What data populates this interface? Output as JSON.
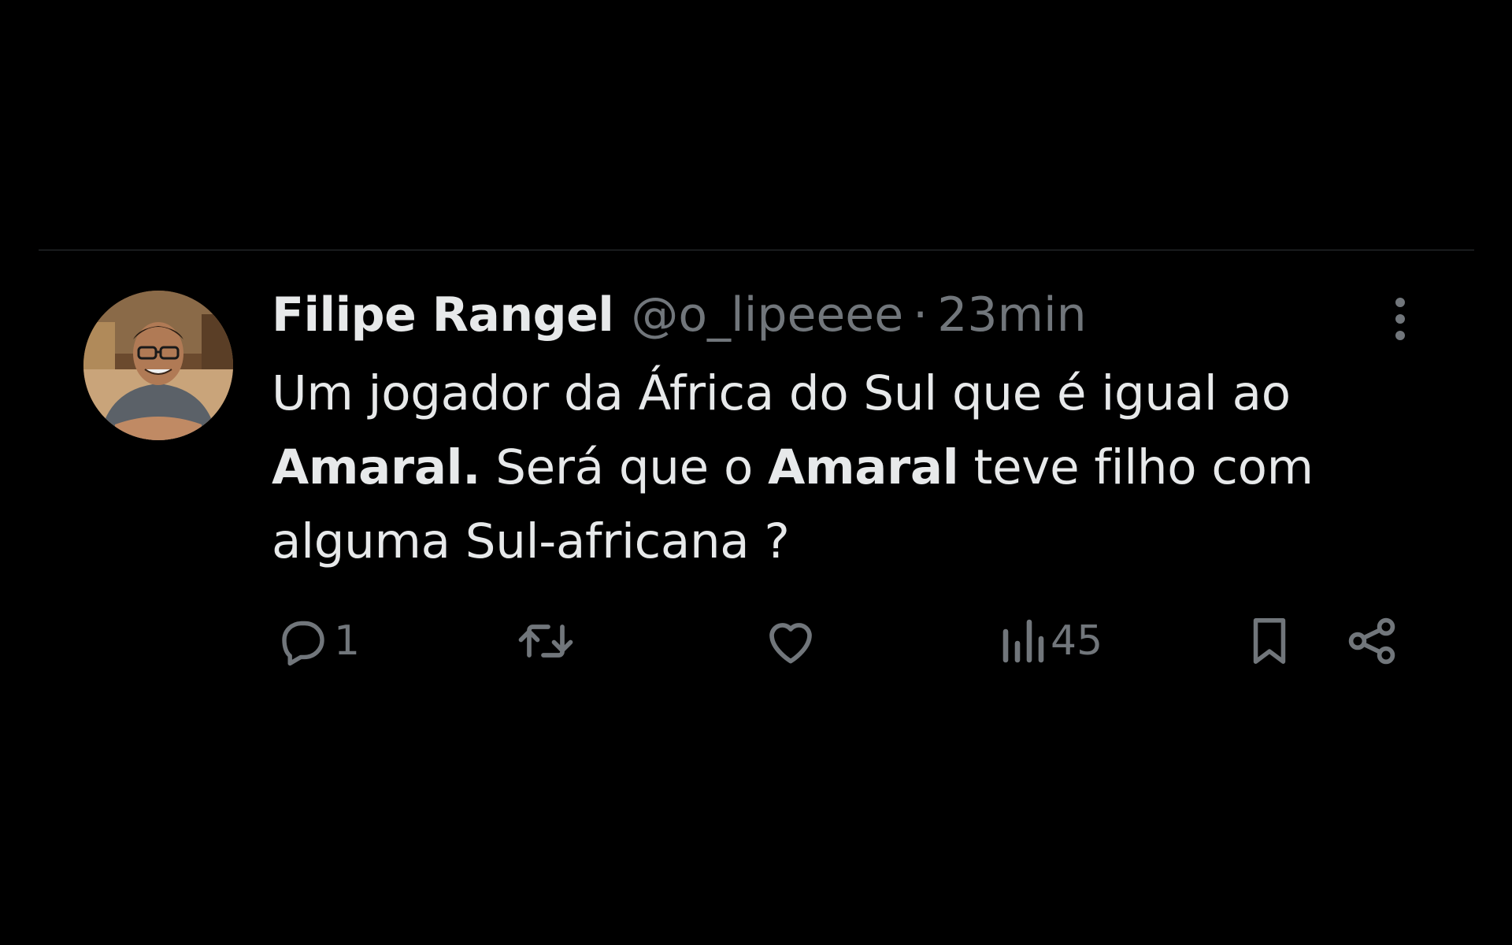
{
  "tweet": {
    "author": {
      "display_name": "Filipe Rangel",
      "handle": "@o_lipeeee"
    },
    "separator": "·",
    "time": "23min",
    "body": {
      "line1": "Um jogador da África do Sul que é igual ao",
      "line2": {
        "bold1": "Amaral.",
        "text1": " Será que o ",
        "bold2": "Amaral",
        "text2": " teve filho com"
      },
      "line3": "alguma Sul-africana ?"
    },
    "actions": {
      "reply_count": "1",
      "views_count": "45"
    }
  },
  "icons": {
    "reply": "reply-bubble-icon",
    "retweet": "retweet-icon",
    "like": "heart-icon",
    "views": "views-bar-chart-icon",
    "bookmark": "bookmark-icon",
    "share": "share-icon",
    "more": "more-vertical-icon"
  },
  "colors": {
    "background": "#000000",
    "primary_text": "#e7e9ea",
    "secondary_text": "#71767b",
    "divider": "#2f3336"
  }
}
